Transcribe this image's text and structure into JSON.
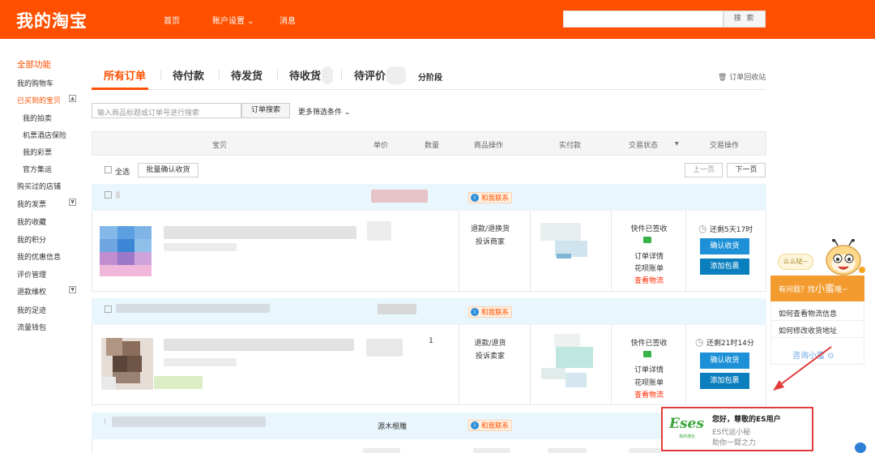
{
  "header": {
    "logo": "我的淘宝",
    "nav": [
      "首页",
      "账户设置 ⌄",
      "消息"
    ],
    "search_button": "搜 索"
  },
  "sidebar": {
    "items": [
      {
        "label": "全部功能"
      },
      {
        "label": "我的购物车"
      },
      {
        "label": "已买到的宝贝"
      },
      {
        "label": "我的拍卖"
      },
      {
        "label": "机票酒店保险"
      },
      {
        "label": "我的彩票"
      },
      {
        "label": "官方集运"
      },
      {
        "label": "购买过的店铺"
      },
      {
        "label": "我的发票"
      },
      {
        "label": "我的收藏"
      },
      {
        "label": "我的积分"
      },
      {
        "label": "我的优惠信息"
      },
      {
        "label": "评价管理"
      },
      {
        "label": "退款维权"
      },
      {
        "label": "我的足迹"
      },
      {
        "label": "流量钱包"
      }
    ],
    "toggle_up": "▲",
    "toggle_down": "▼"
  },
  "tabs": [
    "所有订单",
    "待付款",
    "待发货",
    "待收货",
    "待评价",
    "分阶段"
  ],
  "recycle_bin": "🗑 订单回收站",
  "filter": {
    "placeholder": "输入商品标题或订单号进行搜索",
    "search_button": "订单搜索",
    "more": "更多筛选条件 ⌄"
  },
  "table_headers": [
    "宝贝",
    "单价",
    "数量",
    "商品操作",
    "实付款",
    "交易状态",
    "▼",
    "交易操作"
  ],
  "batch": {
    "select_all": "全选",
    "confirm_button": "批量确认收货",
    "prev": "上一页",
    "next": "下一页"
  },
  "orders": [
    {
      "contact": "和我联系",
      "quantity": "",
      "item_ops": [
        "退款/退换货",
        "投诉商家"
      ],
      "status": [
        "快件已签收",
        "订单详情",
        "花呗账单",
        "查看物流"
      ],
      "countdown": "还剩5天17时",
      "confirm": "确认收货",
      "add_parcel": "添加包裹"
    },
    {
      "contact": "和我联系",
      "quantity": "1",
      "item_ops": [
        "退款/退货",
        "投诉卖家"
      ],
      "status": [
        "快件已签收",
        "订单详情",
        "花呗账单",
        "查看物流"
      ],
      "countdown": "还剩21时14分",
      "confirm": "确认收货",
      "add_parcel": "添加包裹"
    },
    {
      "shop": "源木根雕",
      "contact": "和我联系"
    }
  ],
  "help_widget": {
    "bubble": "么么哒~",
    "title_prefix": "有问题？找",
    "title_name": "小蜜",
    "title_suffix": "哦~",
    "links": [
      "如何查看物流信息",
      "如何修改收货地址"
    ],
    "consult": "咨询小蜜 ⊙"
  },
  "es_card": {
    "logo": "Eses",
    "logo_sub": "易商通云",
    "title": "您好，尊敬的ES用户",
    "line1": "ES代运小秘",
    "line2": "助你一臂之力"
  },
  "colors": {
    "brand": "#ff5000",
    "link_blue": "#1e90d8",
    "help_orange": "#f39b2f",
    "annotation_red": "#e23b3b"
  }
}
